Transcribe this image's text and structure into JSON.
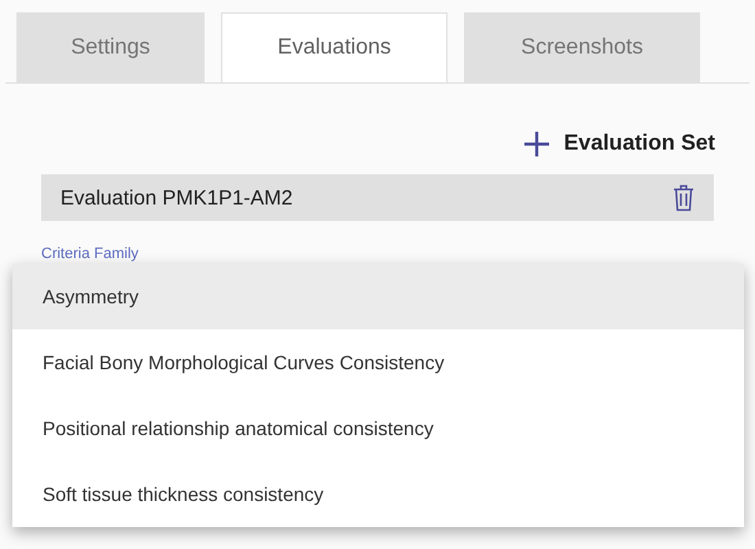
{
  "tabs": [
    {
      "label": "Settings",
      "selected": false
    },
    {
      "label": "Evaluations",
      "selected": true
    },
    {
      "label": "Screenshots",
      "selected": false
    }
  ],
  "add_button": {
    "label": "Evaluation Set"
  },
  "evaluation": {
    "name": "Evaluation PMK1P1-AM2"
  },
  "criteria_field": {
    "label": "Criteria Family"
  },
  "menu": {
    "items": [
      {
        "label": "Asymmetry",
        "selected": true
      },
      {
        "label": "Facial Bony Morphological Curves Consistency",
        "selected": false
      },
      {
        "label": "Positional relationship anatomical consistency",
        "selected": false
      },
      {
        "label": "Soft tissue thickness consistency",
        "selected": false
      }
    ]
  }
}
